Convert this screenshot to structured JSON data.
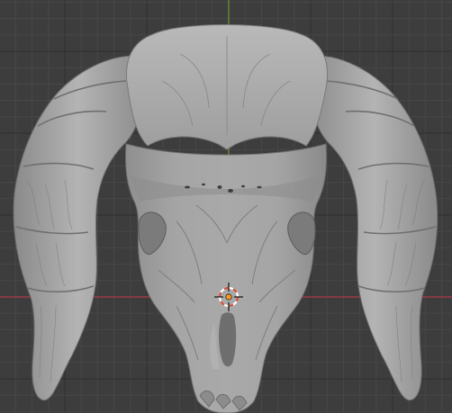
{
  "viewport": {
    "background_color": "#3d3d3d",
    "grid_minor_color": "#474747",
    "grid_major_color": "#2f2f2f",
    "x_axis_color": "#9b3a46",
    "y_axis_color": "#6f9a2f",
    "mesh_color": "#9c9c9c",
    "mesh_highlight_color": "#c2c2c2",
    "mesh_shadow_color": "#5a5a5a",
    "cursor_colors": [
      "#d44d3a",
      "#ffffff"
    ],
    "origin_color": "#ff9a1f"
  },
  "scene": {
    "object": "ram-skull-mesh",
    "cursor_icon": "3d-cursor-icon",
    "origin_icon": "object-origin-icon"
  }
}
